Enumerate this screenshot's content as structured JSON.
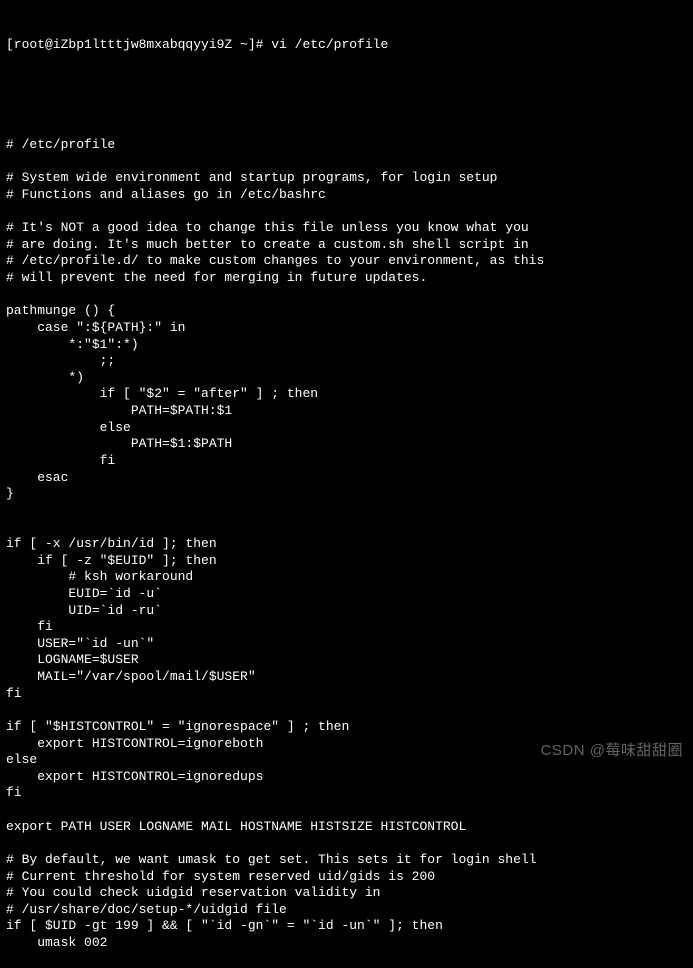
{
  "prompt": "[root@iZbp1ltttjw8mxabqqyyi9Z ~]# vi /etc/profile",
  "lines": [
    "# /etc/profile",
    "",
    "# System wide environment and startup programs, for login setup",
    "# Functions and aliases go in /etc/bashrc",
    "",
    "# It's NOT a good idea to change this file unless you know what you",
    "# are doing. It's much better to create a custom.sh shell script in",
    "# /etc/profile.d/ to make custom changes to your environment, as this",
    "# will prevent the need for merging in future updates.",
    "",
    "pathmunge () {",
    "    case \":${PATH}:\" in",
    "        *:\"$1\":*)",
    "            ;;",
    "        *)",
    "            if [ \"$2\" = \"after\" ] ; then",
    "                PATH=$PATH:$1",
    "            else",
    "                PATH=$1:$PATH",
    "            fi",
    "    esac",
    "}",
    "",
    "",
    "if [ -x /usr/bin/id ]; then",
    "    if [ -z \"$EUID\" ]; then",
    "        # ksh workaround",
    "        EUID=`id -u`",
    "        UID=`id -ru`",
    "    fi",
    "    USER=\"`id -un`\"",
    "    LOGNAME=$USER",
    "    MAIL=\"/var/spool/mail/$USER\"",
    "fi",
    "",
    "if [ \"$HISTCONTROL\" = \"ignorespace\" ] ; then",
    "    export HISTCONTROL=ignoreboth",
    "else",
    "    export HISTCONTROL=ignoredups",
    "fi",
    "",
    "export PATH USER LOGNAME MAIL HOSTNAME HISTSIZE HISTCONTROL",
    "",
    "# By default, we want umask to get set. This sets it for login shell",
    "# Current threshold for system reserved uid/gids is 200",
    "# You could check uidgid reservation validity in",
    "# /usr/share/doc/setup-*/uidgid file",
    "if [ $UID -gt 199 ] && [ \"`id -gn`\" = \"`id -un`\" ]; then",
    "    umask 002"
  ],
  "watermark": "CSDN @莓味甜甜圈"
}
